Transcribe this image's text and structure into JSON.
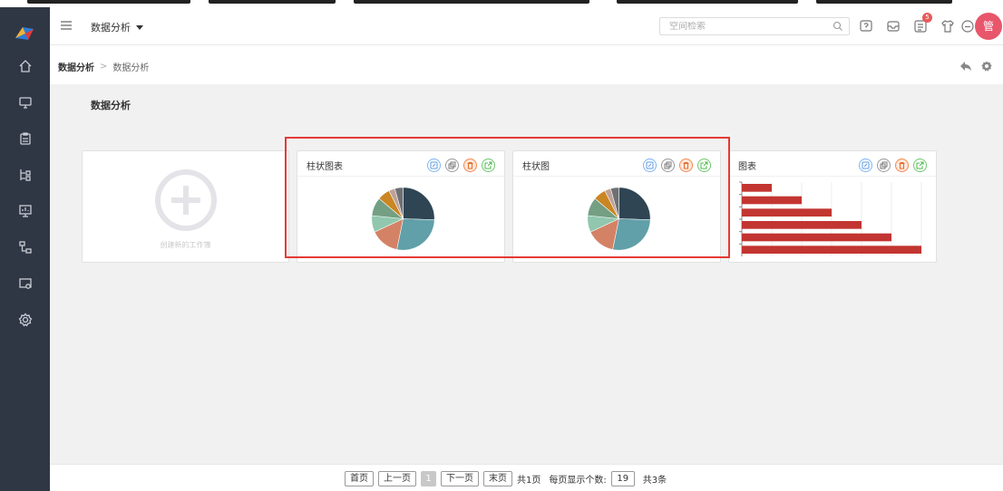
{
  "header": {
    "module_label": "数据分析",
    "search_placeholder": "空间检索",
    "notification_count": "5",
    "avatar_label": "管"
  },
  "sidebar": {
    "items": [
      {
        "icon": "home-icon"
      },
      {
        "icon": "monitor-icon"
      },
      {
        "icon": "clipboard-icon"
      },
      {
        "icon": "org-chart-icon"
      },
      {
        "icon": "presentation-icon"
      },
      {
        "icon": "flow-icon"
      },
      {
        "icon": "device-settings-icon"
      },
      {
        "icon": "settings-icon"
      }
    ]
  },
  "breadcrumb": {
    "root": "数据分析",
    "separator": ">",
    "current": "数据分析"
  },
  "section": {
    "title": "数据分析"
  },
  "create_card": {
    "label": "创建新的工作簿"
  },
  "cards": [
    {
      "title": "柱状图表",
      "chart": "pie"
    },
    {
      "title": "柱状图",
      "chart": "pie"
    },
    {
      "title": "图表",
      "chart": "bar"
    }
  ],
  "card_actions": [
    "edit",
    "copy",
    "delete",
    "open"
  ],
  "pagination": {
    "first": "首页",
    "prev": "上一页",
    "current_page": "1",
    "next": "下一页",
    "last": "末页",
    "total_pages_text": "共1页",
    "page_size_label": "每页显示个数:",
    "page_size": "19",
    "total_items_text": "共3条"
  },
  "colors": {
    "sidebar_bg": "#2f3745",
    "avatar_bg": "#e8566b",
    "highlight": "#e53935",
    "bar_color": "#c23531"
  },
  "chart_data": [
    {
      "type": "pie",
      "series": [
        {
          "values": [
            24,
            26,
            14,
            8,
            9,
            6,
            3,
            4
          ]
        }
      ],
      "colors": [
        "#2f4554",
        "#61a0a8",
        "#d48265",
        "#91c7ae",
        "#749f83",
        "#ca8622",
        "#bda29a",
        "#6e7074"
      ]
    },
    {
      "type": "pie",
      "series": [
        {
          "values": [
            24,
            26,
            14,
            8,
            9,
            6,
            3,
            4
          ]
        }
      ],
      "colors": [
        "#2f4554",
        "#61a0a8",
        "#d48265",
        "#91c7ae",
        "#749f83",
        "#ca8622",
        "#bda29a",
        "#6e7074"
      ]
    },
    {
      "type": "bar",
      "orientation": "horizontal",
      "series": [
        {
          "values": [
            10,
            20,
            30,
            40,
            50,
            60
          ]
        }
      ],
      "xlim": [
        0,
        60
      ],
      "grid": true,
      "color": "#c23531"
    }
  ]
}
